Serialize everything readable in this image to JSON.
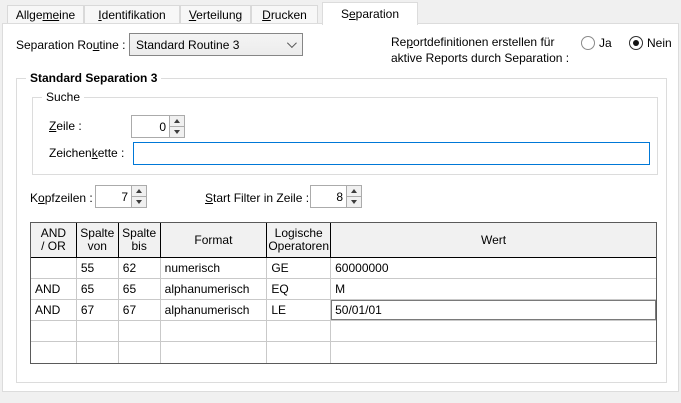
{
  "tabs": [
    {
      "pre": "Allge",
      "mn": "me",
      "post": "ine"
    },
    {
      "pre": "",
      "mn": "I",
      "post": "dentifikation"
    },
    {
      "pre": "",
      "mn": "V",
      "post": "erteilung"
    },
    {
      "pre": "",
      "mn": "D",
      "post": "rucken"
    },
    {
      "pre": "S",
      "mn": "e",
      "post": "paration"
    }
  ],
  "active_tab": "Separation",
  "routine": {
    "label_pre": "Separation Ro",
    "label_mn": "u",
    "label_post": "tine :",
    "value": "Standard Routine 3"
  },
  "report": {
    "line1_pre": "Re",
    "line1_mn": "p",
    "line1_post": "ortdefinitionen erstellen für",
    "line2": "aktive Reports durch Separation :",
    "option_ja": "Ja",
    "option_nein": "Nein",
    "selected": "Nein"
  },
  "separation_group": {
    "title": "Standard Separation 3"
  },
  "suche": {
    "title": "Suche",
    "zeile_mn": "Z",
    "zeile_post": "eile :",
    "zeile_value": "0",
    "zk_pre": "Zeichen",
    "zk_mn": "k",
    "zk_post": "ette :",
    "zk_value": "",
    "zk_placeholder": ""
  },
  "kopfzeilen": {
    "label_pre": "K",
    "label_mn": "o",
    "label_post": "pfzeilen :",
    "value": "7"
  },
  "startfilter": {
    "label_mn": "S",
    "label_post": "tart Filter in Zeile :",
    "value": "8"
  },
  "table": {
    "headers": [
      [
        "AND",
        "/ OR"
      ],
      [
        "Spalte",
        "von"
      ],
      [
        "Spalte",
        "bis"
      ],
      [
        "Format",
        ""
      ],
      [
        "Logische",
        "Operatoren"
      ],
      [
        "Wert",
        ""
      ]
    ],
    "rows": [
      [
        "",
        "55",
        "62",
        "numerisch",
        "GE",
        "60000000"
      ],
      [
        "AND",
        "65",
        "65",
        "alphanumerisch",
        "EQ",
        "M"
      ],
      [
        "AND",
        "67",
        "67",
        "alphanumerisch",
        "LE",
        "50/01/01"
      ],
      [
        "",
        "",
        "",
        "",
        "",
        ""
      ],
      [
        "",
        "",
        "",
        "",
        "",
        ""
      ]
    ],
    "editing_cell": "row 3 / Wert"
  },
  "colors": {
    "focus_border": "#0078d7",
    "page_bg": "#ffffff",
    "dialog_bg": "#f0f0f0",
    "grid_line": "#c9c9c9",
    "table_border": "#5a5a5a"
  }
}
